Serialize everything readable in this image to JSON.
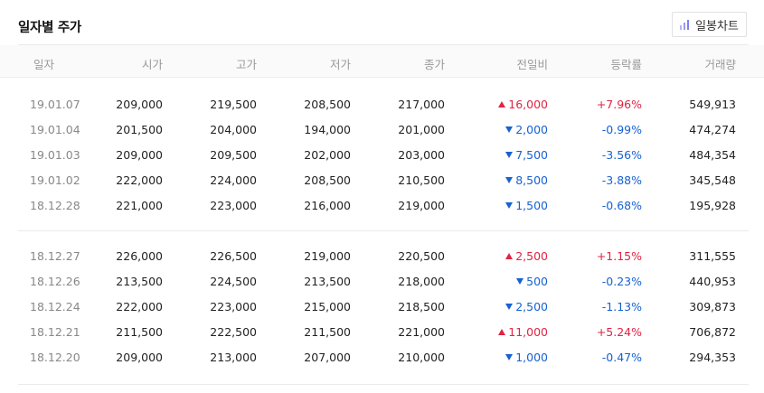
{
  "header": {
    "title": "일자별 주가",
    "chart_button_label": "일봉차트",
    "chart_button_icon": "bar-chart-icon"
  },
  "table": {
    "columns": [
      "일자",
      "시가",
      "고가",
      "저가",
      "종가",
      "전일비",
      "등락률",
      "거래량"
    ],
    "groups": [
      [
        {
          "date": "19.01.07",
          "open": "209,000",
          "high": "219,500",
          "low": "208,500",
          "close": "217,000",
          "dir": "up",
          "change": "16,000",
          "rate": "+7.96%",
          "volume": "549,913"
        },
        {
          "date": "19.01.04",
          "open": "201,500",
          "high": "204,000",
          "low": "194,000",
          "close": "201,000",
          "dir": "down",
          "change": "2,000",
          "rate": "-0.99%",
          "volume": "474,274"
        },
        {
          "date": "19.01.03",
          "open": "209,000",
          "high": "209,500",
          "low": "202,000",
          "close": "203,000",
          "dir": "down",
          "change": "7,500",
          "rate": "-3.56%",
          "volume": "484,354"
        },
        {
          "date": "19.01.02",
          "open": "222,000",
          "high": "224,000",
          "low": "208,500",
          "close": "210,500",
          "dir": "down",
          "change": "8,500",
          "rate": "-3.88%",
          "volume": "345,548"
        },
        {
          "date": "18.12.28",
          "open": "221,000",
          "high": "223,000",
          "low": "216,000",
          "close": "219,000",
          "dir": "down",
          "change": "1,500",
          "rate": "-0.68%",
          "volume": "195,928"
        }
      ],
      [
        {
          "date": "18.12.27",
          "open": "226,000",
          "high": "226,500",
          "low": "219,000",
          "close": "220,500",
          "dir": "up",
          "change": "2,500",
          "rate": "+1.15%",
          "volume": "311,555"
        },
        {
          "date": "18.12.26",
          "open": "213,500",
          "high": "224,500",
          "low": "213,500",
          "close": "218,000",
          "dir": "down",
          "change": "500",
          "rate": "-0.23%",
          "volume": "440,953"
        },
        {
          "date": "18.12.24",
          "open": "222,000",
          "high": "223,000",
          "low": "215,000",
          "close": "218,500",
          "dir": "down",
          "change": "2,500",
          "rate": "-1.13%",
          "volume": "309,873"
        },
        {
          "date": "18.12.21",
          "open": "211,500",
          "high": "222,500",
          "low": "211,500",
          "close": "221,000",
          "dir": "up",
          "change": "11,000",
          "rate": "+5.24%",
          "volume": "706,872"
        },
        {
          "date": "18.12.20",
          "open": "209,000",
          "high": "213,000",
          "low": "207,000",
          "close": "210,000",
          "dir": "down",
          "change": "1,000",
          "rate": "-0.47%",
          "volume": "294,353"
        }
      ]
    ]
  },
  "colors": {
    "up": "#e12343",
    "down": "#1761d1",
    "header_bg": "#fafafa",
    "icon_accent": "#8c8cf0"
  }
}
